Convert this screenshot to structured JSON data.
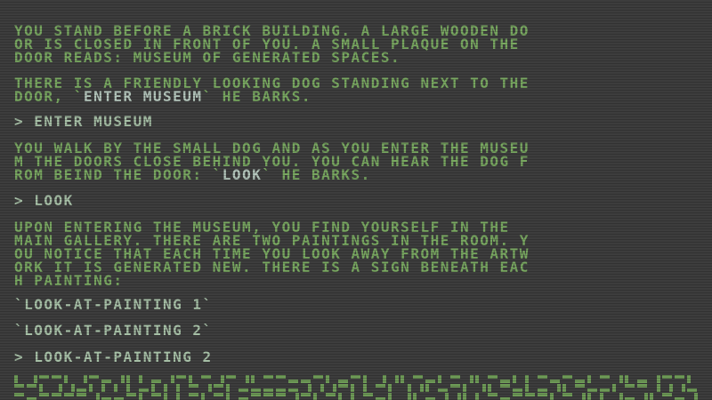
{
  "paragraphs": {
    "p1": [
      "YOU STAND BEFORE A BRICK BUILDING. A LARGE WOODEN DO",
      "OR IS CLOSED IN FRONT OF YOU. A SMALL PLAQUE ON THE",
      "DOOR READS: MUSEUM OF GENERATED SPACES."
    ],
    "p2a_prefix": "THERE IS A FRIENDLY LOOKING DOG STANDING NEXT TO THE",
    "p2b_prefix": "DOOR, `",
    "p2b_highlight": "ENTER MUSEUM",
    "p2b_suffix": "` HE BARKS.",
    "p3": [
      "YOU WALK BY THE SMALL DOG AND AS YOU ENTER THE MUSEU",
      "M THE DOORS CLOSE BEHIND YOU. YOU CAN HEAR THE DOG F"
    ],
    "p3c_prefix": "ROM BEIND THE DOOR: `",
    "p3c_highlight": "LOOK",
    "p3c_suffix": "` HE BARKS.",
    "p4": [
      "UPON ENTERING THE MUSEUM, YOU FIND YOURSELF IN THE",
      "MAIN GALLERY. THERE ARE TWO PAINTINGS IN THE ROOM. Y",
      "OU NOTICE THAT EACH TIME YOU LOOK AWAY FROM THE ARTW",
      "ORK IT IS GENERATED NEW. THERE IS A SIGN BENEATH EAC",
      "H PAINTING:"
    ]
  },
  "commands": {
    "c1": "> ENTER MUSEUM",
    "c2": "> LOOK",
    "c3": "> LOOK-AT-PAINTING 2"
  },
  "signs": {
    "s1": "`LOOK-AT-PAINTING 1`",
    "s2": "`LOOK-AT-PAINTING 2`"
  },
  "colors": {
    "background": "#3d3d3d",
    "text": "#79a861",
    "command": "#a6bfa6",
    "highlight": "#b5c7bd",
    "maze": "#6e9a57"
  }
}
